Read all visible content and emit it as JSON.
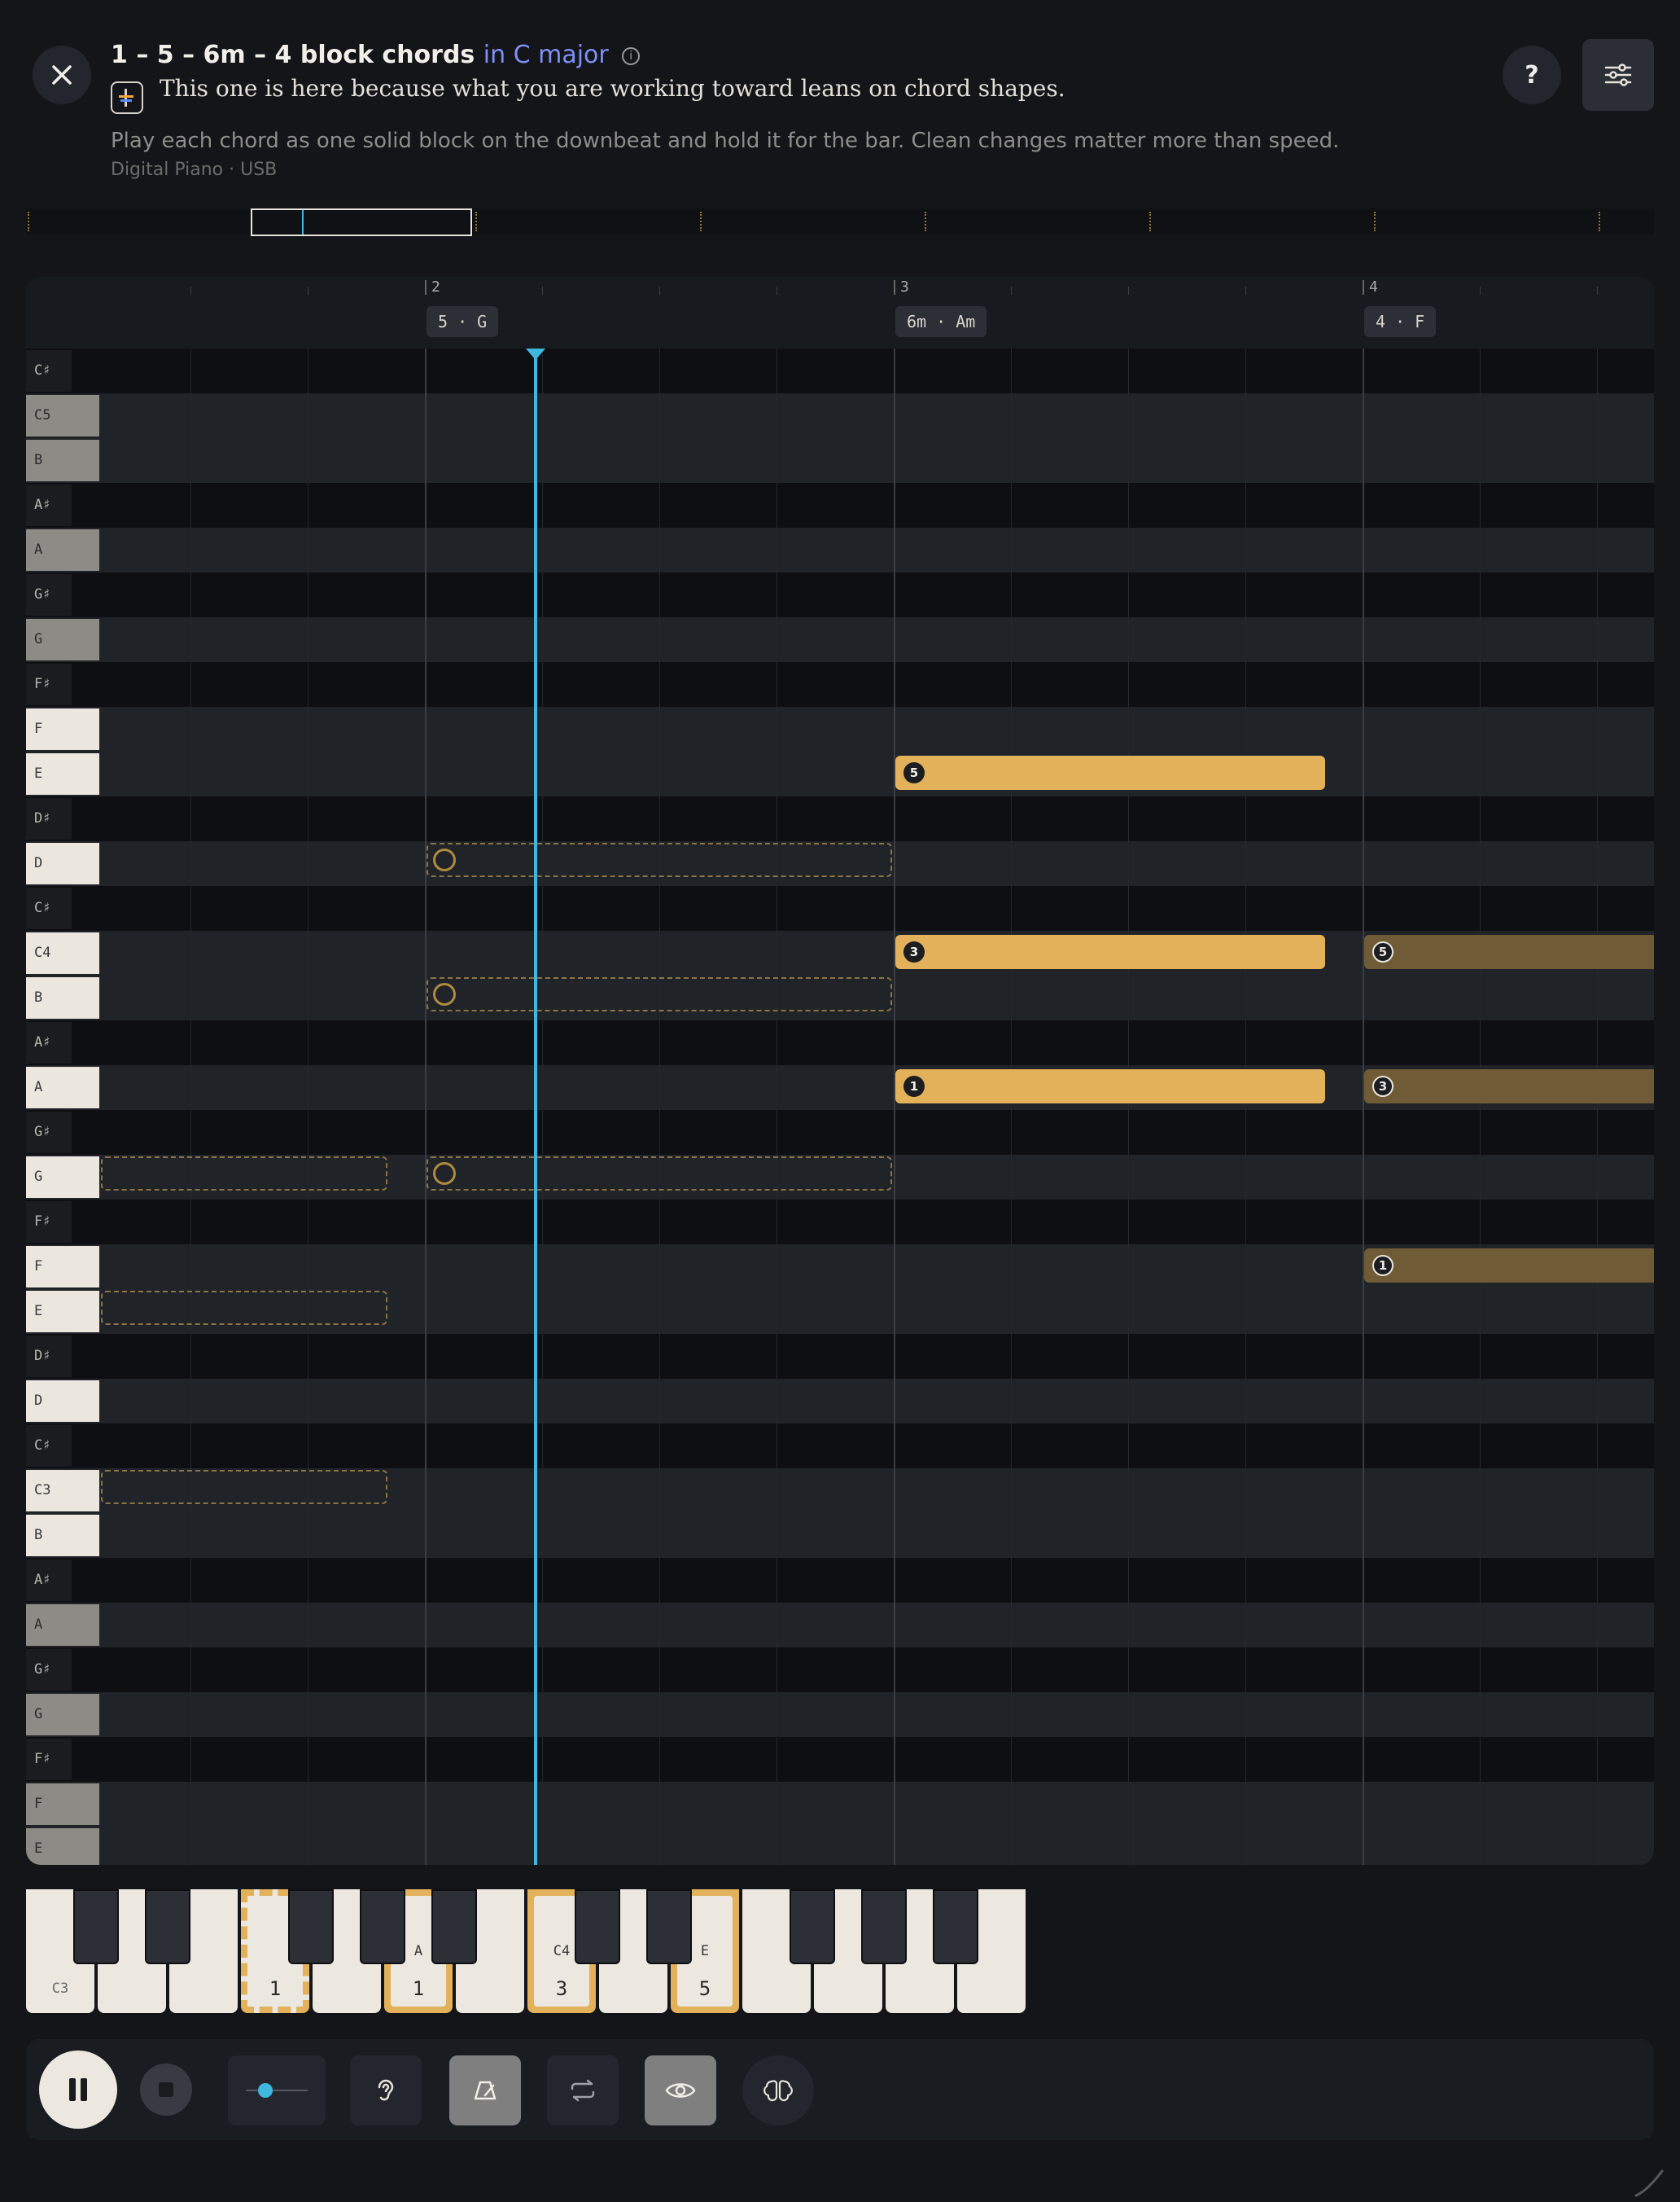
{
  "header": {
    "title": "1 – 5 – 6m – 4 block chords",
    "key": "in C major",
    "reason": "This one is here because what you are working toward leans on chord shapes.",
    "description": "Play each chord as one solid block on the downbeat and hold it for the bar. Clean changes matter more than speed.",
    "device": "Digital Piano · USB",
    "help_label": "?"
  },
  "ruler": {
    "bars": [
      "2",
      "3",
      "4"
    ],
    "chords": [
      "5 · G",
      "6m · Am",
      "4 · F"
    ]
  },
  "keys": [
    "C♯",
    "C5",
    "B",
    "A♯",
    "A",
    "G♯",
    "G",
    "F♯",
    "F",
    "E",
    "D♯",
    "D",
    "C♯",
    "C4",
    "B",
    "A♯",
    "A",
    "G♯",
    "G",
    "F♯",
    "F",
    "E",
    "D♯",
    "D",
    "C♯",
    "C3",
    "B",
    "A♯",
    "A",
    "G♯",
    "G",
    "F♯",
    "F",
    "E"
  ],
  "fingers": {
    "am_e": "5",
    "am_c": "3",
    "am_a": "1",
    "f_c": "5",
    "f_a": "3",
    "f_f": "1"
  },
  "keyboard": {
    "c3": "C3",
    "labels": {
      "a": "A",
      "c4": "C4",
      "e": "E"
    },
    "fingers": {
      "g": "1",
      "a": "1",
      "c4": "3",
      "e": "5"
    }
  },
  "colors": {
    "accent": "#e3b159",
    "playhead": "#3fb8e0",
    "key_text": "#7f8ff5"
  }
}
